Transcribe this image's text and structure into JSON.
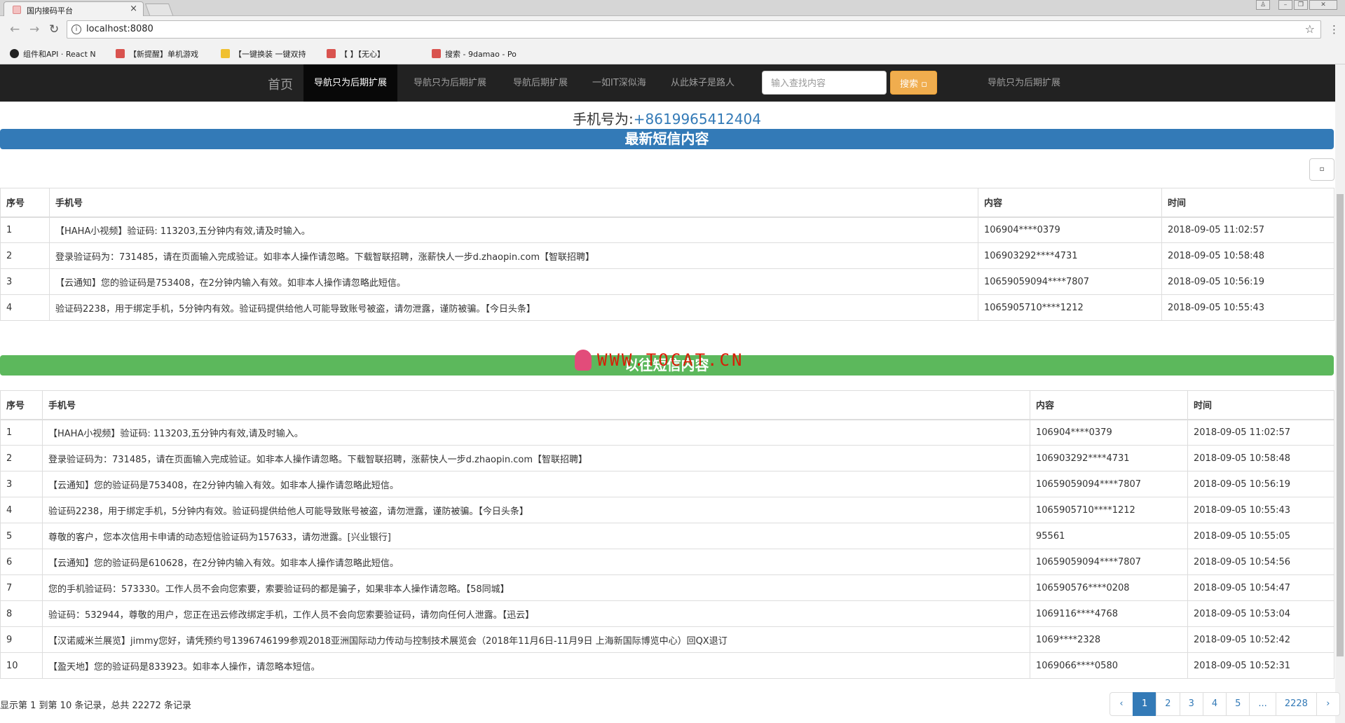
{
  "browser": {
    "tab_title": "国内接码平台",
    "tab_close": "×",
    "url": "localhost:8080",
    "bookmarks": [
      {
        "label": "组件和API · React N",
        "icon": "react-icon"
      },
      {
        "label": "【新提醒】单机游戏",
        "icon": "bookmark-icon"
      },
      {
        "label": "【一键换装 一键双持",
        "icon": "bookmark-icon"
      },
      {
        "label": "【        】【无心】",
        "icon": "bookmark-icon"
      },
      {
        "label": "搜索 - 9damao - Po",
        "icon": "bookmark-icon"
      }
    ]
  },
  "navbar": {
    "brand": "首页",
    "links": [
      "导航只为后期扩展",
      "导航只为后期扩展",
      "导航后期扩展",
      "一如IT深似海",
      "从此妹子是路人"
    ],
    "right_link": "导航只为后期扩展",
    "search_placeholder": "输入查找内容",
    "search_button": "搜索 ▫"
  },
  "phone": {
    "label": "手机号为:",
    "number": "+8619965412404"
  },
  "latest_title": "最新短信内容",
  "history_title": "以往短信内容",
  "watermark": "WWW.TOCAT.CN",
  "table_headers": {
    "index": "序号",
    "phone": "手机号",
    "content": "内容",
    "time": "时间"
  },
  "latest_rows": [
    {
      "index": "1",
      "message": "【HAHA小视频】验证码: 113203,五分钟内有效,请及时输入。",
      "sender": "106904****0379",
      "time": "2018-09-05 11:02:57"
    },
    {
      "index": "2",
      "message": "登录验证码为：731485，请在页面输入完成验证。如非本人操作请忽略。下载智联招聘，涨薪快人一步d.zhaopin.com【智联招聘】",
      "sender": "106903292****4731",
      "time": "2018-09-05 10:58:48"
    },
    {
      "index": "3",
      "message": "【云通知】您的验证码是753408，在2分钟内输入有效。如非本人操作请忽略此短信。",
      "sender": "10659059094****7807",
      "time": "2018-09-05 10:56:19"
    },
    {
      "index": "4",
      "message": "验证码2238，用于绑定手机，5分钟内有效。验证码提供给他人可能导致账号被盗，请勿泄露，谨防被骗。【今日头条】",
      "sender": "1065905710****1212",
      "time": "2018-09-05 10:55:43"
    }
  ],
  "history_rows": [
    {
      "index": "1",
      "message": "【HAHA小视频】验证码: 113203,五分钟内有效,请及时输入。",
      "sender": "106904****0379",
      "time": "2018-09-05 11:02:57"
    },
    {
      "index": "2",
      "message": "登录验证码为：731485，请在页面输入完成验证。如非本人操作请忽略。下载智联招聘，涨薪快人一步d.zhaopin.com【智联招聘】",
      "sender": "106903292****4731",
      "time": "2018-09-05 10:58:48"
    },
    {
      "index": "3",
      "message": "【云通知】您的验证码是753408，在2分钟内输入有效。如非本人操作请忽略此短信。",
      "sender": "10659059094****7807",
      "time": "2018-09-05 10:56:19"
    },
    {
      "index": "4",
      "message": "验证码2238，用于绑定手机，5分钟内有效。验证码提供给他人可能导致账号被盗，请勿泄露，谨防被骗。【今日头条】",
      "sender": "1065905710****1212",
      "time": "2018-09-05 10:55:43"
    },
    {
      "index": "5",
      "message": "尊敬的客户，您本次信用卡申请的动态短信验证码为157633，请勿泄露。[兴业银行]",
      "sender": "95561",
      "time": "2018-09-05 10:55:05"
    },
    {
      "index": "6",
      "message": "【云通知】您的验证码是610628，在2分钟内输入有效。如非本人操作请忽略此短信。",
      "sender": "10659059094****7807",
      "time": "2018-09-05 10:54:56"
    },
    {
      "index": "7",
      "message": "您的手机验证码：573330。工作人员不会向您索要，索要验证码的都是骗子，如果非本人操作请忽略。【58同城】",
      "sender": "106590576****0208",
      "time": "2018-09-05 10:54:47"
    },
    {
      "index": "8",
      "message": "验证码：532944，尊敬的用户，您正在迅云修改绑定手机，工作人员不会向您索要验证码，请勿向任何人泄露。【迅云】",
      "sender": "1069116****4768",
      "time": "2018-09-05 10:53:04"
    },
    {
      "index": "9",
      "message": "【汉诺威米兰展览】jimmy您好，请凭预约号1396746199参观2018亚洲国际动力传动与控制技术展览会（2018年11月6日-11月9日 上海新国际博览中心）回QX退订",
      "sender": "1069****2328",
      "time": "2018-09-05 10:52:42"
    },
    {
      "index": "10",
      "message": "【盈天地】您的验证码是833923。如非本人操作，请忽略本短信。",
      "sender": "1069066****0580",
      "time": "2018-09-05 10:52:31"
    }
  ],
  "pagination": {
    "info": "显示第 1 到第 10 条记录，总共 22272 条记录",
    "pages": [
      "‹",
      "1",
      "2",
      "3",
      "4",
      "5",
      "...",
      "2228",
      "›"
    ],
    "active": "1"
  }
}
